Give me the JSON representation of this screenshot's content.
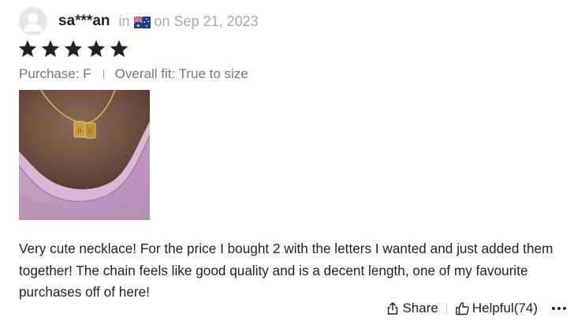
{
  "review": {
    "username": "sa***an",
    "location_prefix": "in",
    "country_flag_icon": "australia-flag-icon",
    "date_text": "on Sep 21, 2023",
    "rating": 5,
    "rating_max": 5,
    "purchase": "Purchase: F",
    "overall_fit": "Overall fit: True to size",
    "photo_description_icon": "review-photo",
    "text": "Very cute necklace! For the price I bought 2 with the letters I wanted and just added them together! The chain feels like good quality and is a decent length, one of my favourite purchases off of here!",
    "actions": {
      "share_label": "Share",
      "share_icon": "share-icon",
      "helpful_label": "Helpful(74)",
      "helpful_icon": "thumbs-up-icon",
      "more_icon": "more-icon"
    }
  },
  "colors": {
    "text_primary": "#222222",
    "text_muted": "#a8a8a8",
    "text_secondary": "#777777",
    "star": "#222222",
    "avatar_bg": "#e6e6e6"
  }
}
